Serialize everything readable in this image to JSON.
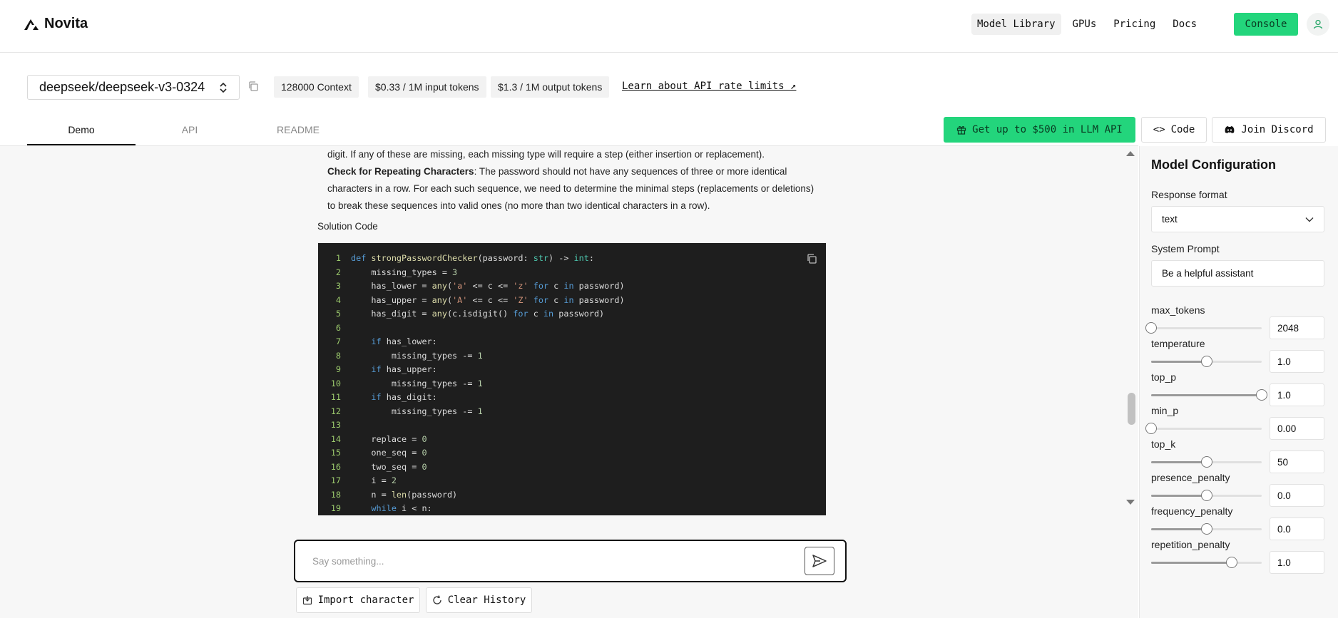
{
  "nav": {
    "brand": "Novita",
    "links": [
      "Model Library",
      "GPUs",
      "Pricing",
      "Docs"
    ],
    "console": "Console"
  },
  "model": {
    "name": "deepseek/deepseek-v3-0324",
    "context": "128000 Context",
    "input_price": "$0.33 / 1M input tokens",
    "output_price": "$1.3 / 1M output tokens",
    "rate_link": "Learn about API rate limits ↗"
  },
  "tabs": [
    "Demo",
    "API",
    "README"
  ],
  "actions": {
    "promo": "Get up to $500 in LLM API",
    "code": "Code",
    "discord": "Join Discord"
  },
  "chat": {
    "line1": "digit. If any of these are missing, each missing type will require a step (either insertion or replacement).",
    "repeat_heading": "Check for Repeating Characters",
    "repeat_body_1": ": The password should not have any sequences of three or more identical",
    "repeat_body_2": "characters in a row. For each such sequence, we need to determine the minimal steps (replacements or deletions)",
    "repeat_body_3": "to break these sequences into valid ones (no more than two identical characters in a row).",
    "solution_label": "Solution Code",
    "input_placeholder": "Say something...",
    "import_btn": "Import character",
    "clear_btn": "Clear History"
  },
  "code_lines": [
    "def strongPasswordChecker(password: str) -> int:",
    "    missing_types = 3",
    "    has_lower = any('a' <= c <= 'z' for c in password)",
    "    has_upper = any('A' <= c <= 'Z' for c in password)",
    "    has_digit = any(c.isdigit() for c in password)",
    "",
    "    if has_lower:",
    "        missing_types -= 1",
    "    if has_upper:",
    "        missing_types -= 1",
    "    if has_digit:",
    "        missing_types -= 1",
    "",
    "    replace = 0",
    "    one_seq = 0",
    "    two_seq = 0",
    "    i = 2",
    "    n = len(password)",
    "    while i < n:"
  ],
  "config": {
    "title": "Model Configuration",
    "response_format_label": "Response format",
    "response_format_value": "text",
    "system_prompt_label": "System Prompt",
    "system_prompt_value": "Be a helpful assistant",
    "params": [
      {
        "name": "max_tokens",
        "value": "2048",
        "fraction": 0.0
      },
      {
        "name": "temperature",
        "value": "1.0",
        "fraction": 0.5
      },
      {
        "name": "top_p",
        "value": "1.0",
        "fraction": 1.0
      },
      {
        "name": "min_p",
        "value": "0.00",
        "fraction": 0.0
      },
      {
        "name": "top_k",
        "value": "50",
        "fraction": 0.5
      },
      {
        "name": "presence_penalty",
        "value": "0.0",
        "fraction": 0.5
      },
      {
        "name": "frequency_penalty",
        "value": "0.0",
        "fraction": 0.5
      },
      {
        "name": "repetition_penalty",
        "value": "1.0",
        "fraction": 0.73
      }
    ]
  },
  "colors": {
    "accent": "#23d57c",
    "code_bg": "#1e1e1e"
  }
}
